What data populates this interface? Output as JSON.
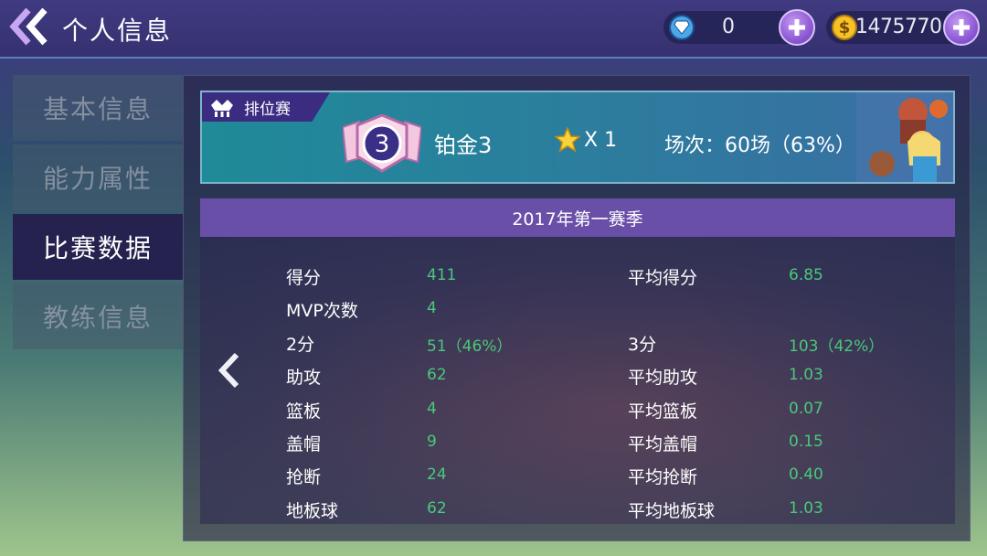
{
  "header": {
    "title": "个人信息",
    "diamond_value": "0",
    "gold_value": "1475770",
    "coin_symbol": "$"
  },
  "sidebar": {
    "items": [
      {
        "label": "基本信息"
      },
      {
        "label": "能力属性"
      },
      {
        "label": "比赛数据"
      },
      {
        "label": "教练信息"
      }
    ]
  },
  "rank": {
    "tag_label": "排位赛",
    "badge_number": "3",
    "rank_name": "铂金3",
    "star_count": "X 1",
    "matches": "场次：60场（63%）"
  },
  "season": {
    "title": "2017年第一赛季"
  },
  "stats": {
    "left": [
      {
        "label": "得分",
        "value": "411"
      },
      {
        "label": "MVP次数",
        "value": "4"
      },
      {
        "label": "2分",
        "value": "51（46%）"
      },
      {
        "label": "助攻",
        "value": "62"
      },
      {
        "label": "篮板",
        "value": "4"
      },
      {
        "label": "盖帽",
        "value": "9"
      },
      {
        "label": "抢断",
        "value": "24"
      },
      {
        "label": "地板球",
        "value": "62"
      }
    ],
    "right": [
      {
        "label": "平均得分",
        "value": "6.85"
      },
      {
        "label": "3分",
        "value": "103（42%）"
      },
      {
        "label": "平均助攻",
        "value": "1.03"
      },
      {
        "label": "平均篮板",
        "value": "0.07"
      },
      {
        "label": "平均盖帽",
        "value": "0.15"
      },
      {
        "label": "平均抢断",
        "value": "0.40"
      },
      {
        "label": "平均地板球",
        "value": "1.03"
      }
    ]
  },
  "colors": {
    "stat_value": "#49c97a",
    "active_tab_bg": "#26224f",
    "season_bar": "#6a4fa8"
  },
  "icons": {
    "back": "double-chevron-left-icon",
    "diamond": "diamond-icon",
    "coin": "coin-icon",
    "plus": "plus-icon",
    "crown": "crown-icon",
    "badge": "rank-badge-icon",
    "star": "star-icon",
    "prev": "chevron-left-icon"
  }
}
